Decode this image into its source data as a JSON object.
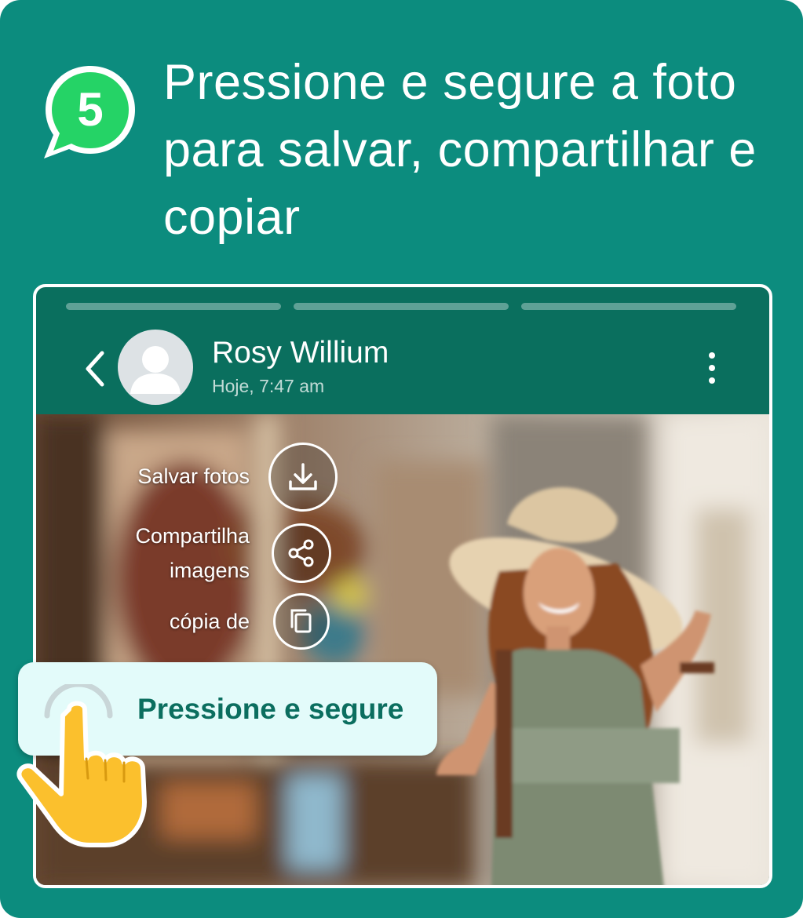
{
  "step": {
    "number": "5"
  },
  "headline": "Pressione e segure a foto para salvar, compartilhar e copiar",
  "status": {
    "contact_name": "Rosy Willium",
    "timestamp": "Hoje, 7:47 am",
    "progress_segments": 3
  },
  "actions": {
    "save": {
      "label": "Salvar fotos",
      "icon": "download-icon"
    },
    "share": {
      "label_line1": "Compartilha",
      "label_line2": "imagens",
      "icon": "share-icon"
    },
    "copy": {
      "label": "cópia de",
      "icon": "copy-icon"
    }
  },
  "tooltip": {
    "text": "Pressione e segure",
    "icon": "pointing-hand-icon"
  },
  "colors": {
    "background": "#0c8c7e",
    "header": "#0a6f5e",
    "badge": "#25d366",
    "tooltip_bg": "#e3fbfa",
    "tooltip_text": "#0b6e5f",
    "hand": "#fbc02d"
  }
}
